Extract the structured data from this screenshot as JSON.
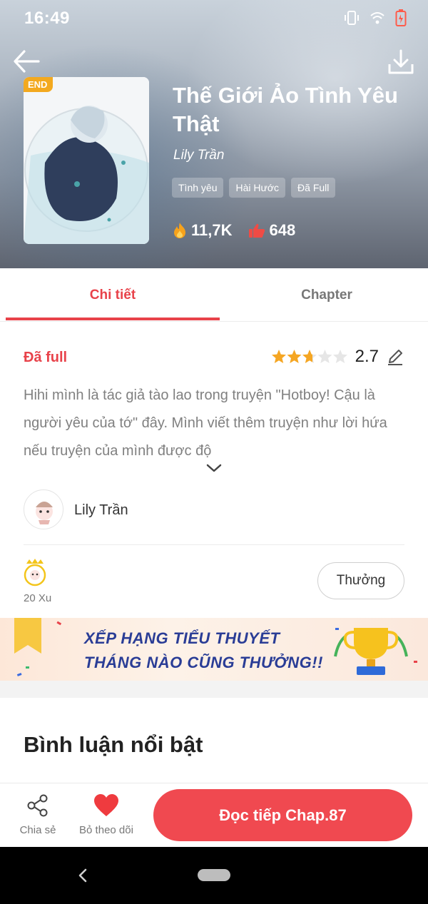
{
  "status_bar": {
    "time": "16:49"
  },
  "header": {
    "badge": "END",
    "title": "Thế Giới Ảo Tình Yêu Thật",
    "author": "Lily Trần",
    "tags": [
      "Tình yêu",
      "Hài Hước",
      "Đã Full"
    ],
    "views": "11,7K",
    "likes": "648"
  },
  "tabs": [
    {
      "label": "Chi tiết",
      "active": true
    },
    {
      "label": "Chapter",
      "active": false
    }
  ],
  "details": {
    "status": "Đã full",
    "rating": "2.7",
    "rating_value": 2.7,
    "rating_max": 5,
    "description": "Hihi mình là tác giả tào lao trong truyện \"Hotboy! Cậu là người yêu của tớ\" đây. Mình viết thêm truyện như lời hứa nếu truyện của mình được độ"
  },
  "author_row": {
    "name": "Lily Trần"
  },
  "reward": {
    "coins": "20 Xu",
    "button": "Thưởng"
  },
  "banner": {
    "line1": "XẾP HẠNG TIỂU THUYẾT",
    "line2": "THÁNG NÀO CŨNG THƯỞNG!!"
  },
  "comments": {
    "title": "Bình luận nổi bật"
  },
  "bottom_bar": {
    "share": "Chia sẻ",
    "unfollow": "Bỏ theo dõi",
    "read": "Đọc tiếp Chap.87"
  },
  "colors": {
    "accent": "#f04950",
    "tab_active": "#e8424a",
    "badge": "#f3a91f"
  }
}
